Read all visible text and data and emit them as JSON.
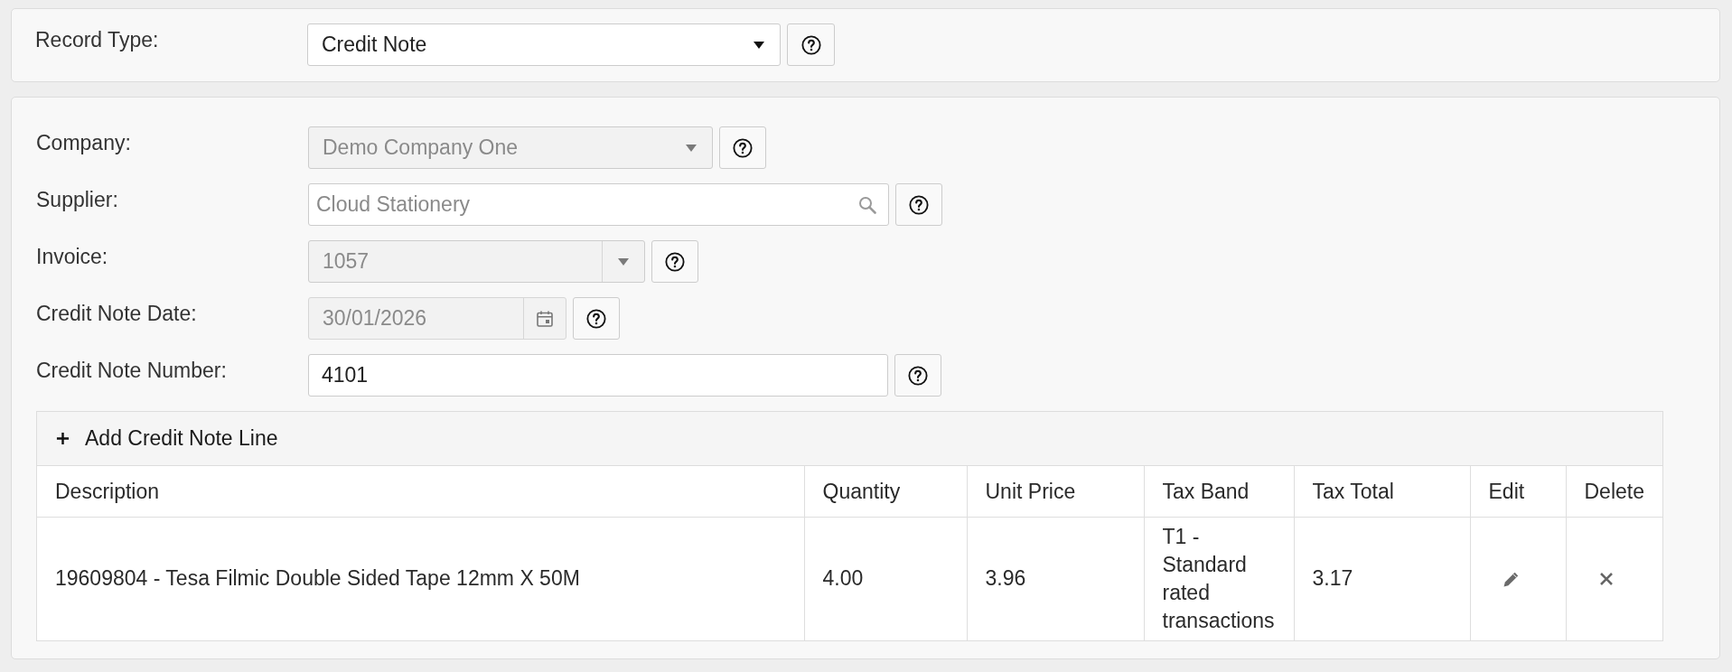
{
  "record_type": {
    "label": "Record Type:",
    "kind": "select",
    "value": "Credit Note",
    "disabled": false
  },
  "form": {
    "fields": [
      {
        "kind": "select",
        "label": "Company:",
        "value": "Demo Company One",
        "disabled": true
      },
      {
        "kind": "search",
        "label": "Supplier:",
        "value": "Cloud Stationery",
        "disabled": true
      },
      {
        "kind": "combo",
        "label": "Invoice:",
        "value": "1057",
        "disabled": true
      },
      {
        "kind": "date",
        "label": "Credit Note Date:",
        "value": "30/01/2026",
        "disabled": true
      },
      {
        "kind": "text",
        "label": "Credit Note Number:",
        "value": "4101",
        "disabled": false
      }
    ]
  },
  "lines": {
    "add_button": "Add Credit Note Line",
    "columns": [
      "Description",
      "Quantity",
      "Unit Price",
      "Tax Band",
      "Tax Total",
      "Edit",
      "Delete"
    ],
    "rows": [
      {
        "cells": [
          "19609804 - Tesa Filmic Double Sided Tape 12mm X 50M",
          "4.00",
          "3.96",
          "T1 - Standard rated transactions",
          "3.17"
        ]
      }
    ]
  }
}
